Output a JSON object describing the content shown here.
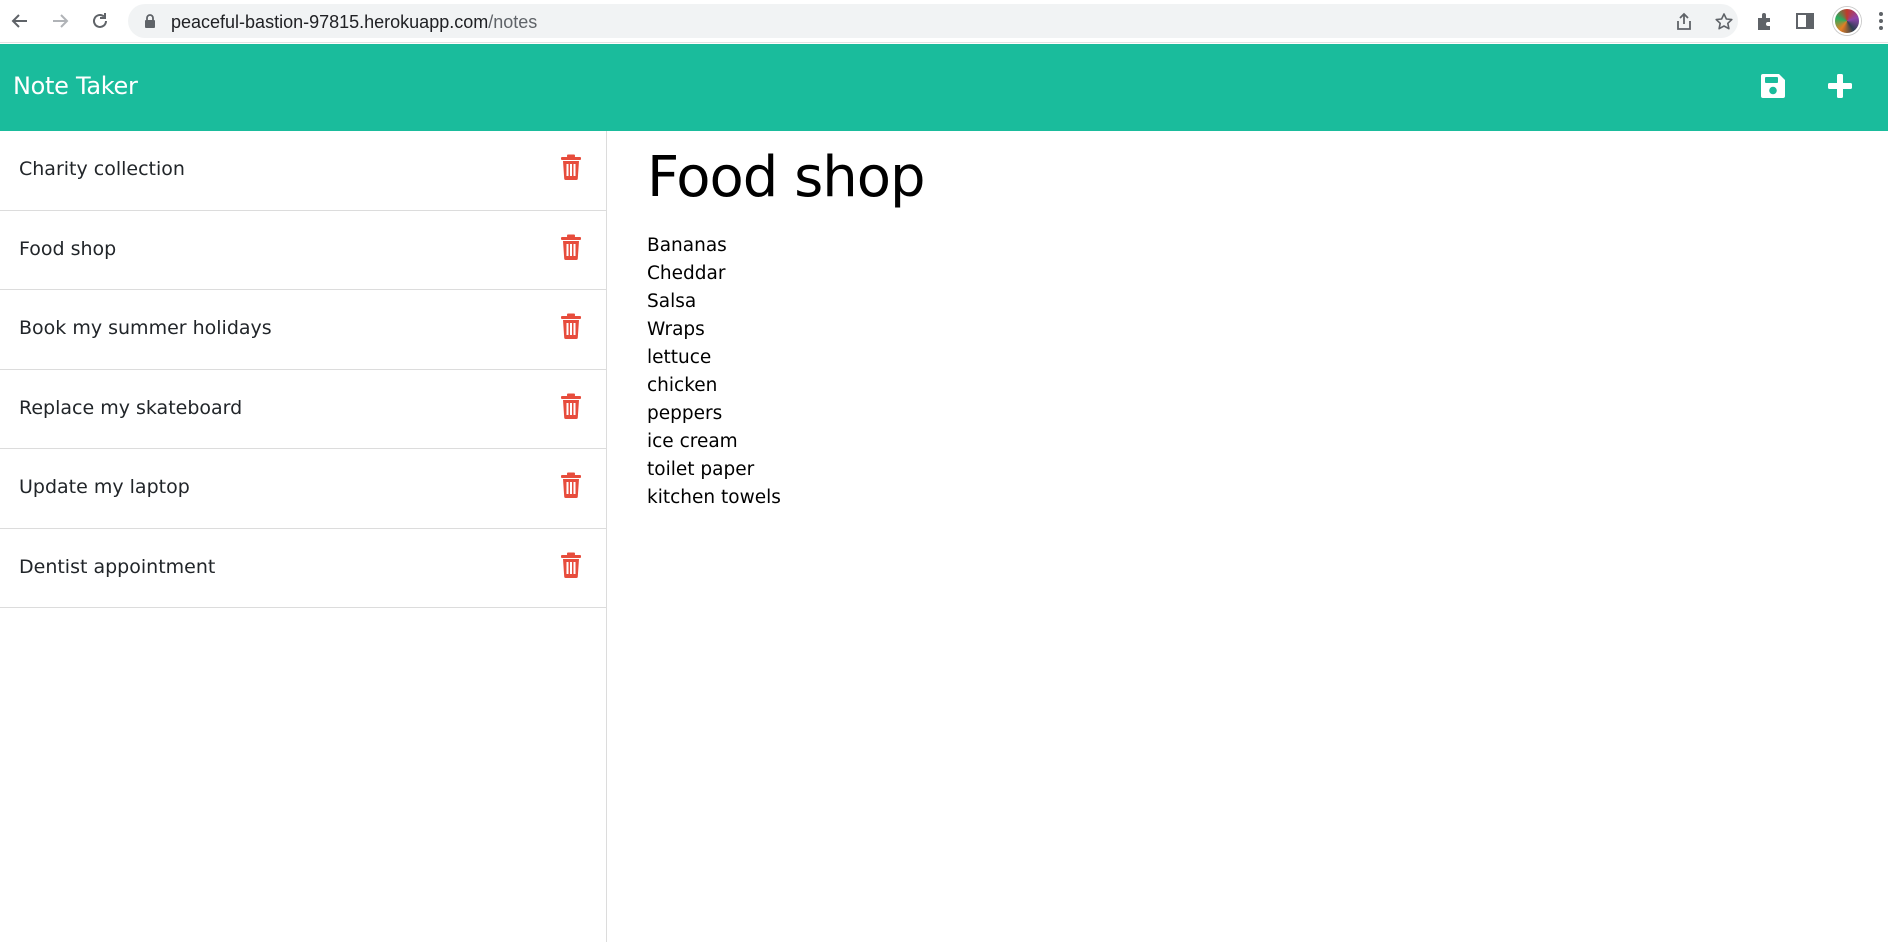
{
  "browser": {
    "url_host": "peaceful-bastion-97815.herokuapp.com",
    "url_path": "/notes"
  },
  "header": {
    "brand": "Note Taker",
    "save_icon": "save-icon",
    "new_icon": "plus-icon"
  },
  "notes": [
    {
      "title": "Charity collection"
    },
    {
      "title": "Food shop"
    },
    {
      "title": "Book my summer holidays"
    },
    {
      "title": "Replace my skateboard"
    },
    {
      "title": "Update my laptop"
    },
    {
      "title": "Dentist appointment"
    }
  ],
  "active_note": {
    "title": "Food shop",
    "text": "Bananas\nCheddar\nSalsa\nWraps\nlettuce\nchicken\npeppers\nice cream\ntoilet paper\nkitchen towels"
  },
  "colors": {
    "header_bg": "#1abc9c",
    "delete": "#e74c3c"
  }
}
